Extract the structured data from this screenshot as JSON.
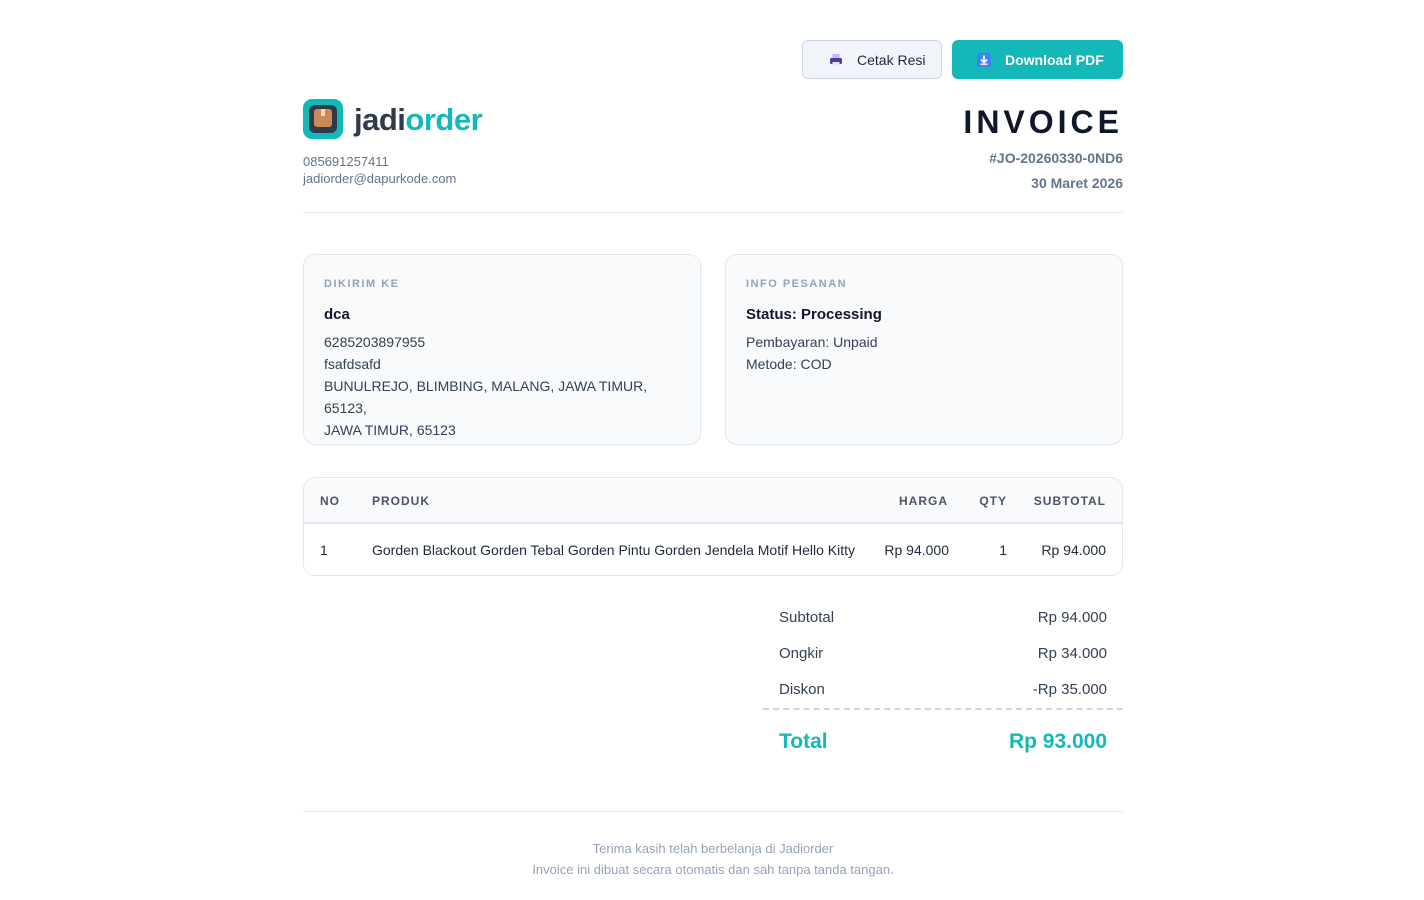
{
  "actions": {
    "print_label": "Cetak Resi",
    "pdf_label": "Download PDF"
  },
  "brand": {
    "name_a": "jadi",
    "name_b": "order",
    "phone": "085691257411",
    "email": "jadiorder@dapurkode.com"
  },
  "invoice": {
    "title": "INVOICE",
    "number": "#JO-20260330-0ND6",
    "date": "30 Maret 2026"
  },
  "shipping": {
    "label": "DIKIRIM KE",
    "name": "dca",
    "phone": "6285203897955",
    "line1": "fsafdsafd",
    "line2": "BUNULREJO, BLIMBING, MALANG, JAWA TIMUR, 65123,",
    "line3": "JAWA TIMUR, 65123"
  },
  "order_info": {
    "label": "INFO PESANAN",
    "status": "Status: Processing",
    "payment": "Pembayaran: Unpaid",
    "method": "Metode: COD"
  },
  "table": {
    "headers": {
      "no": "NO",
      "product": "PRODUK",
      "price": "HARGA",
      "qty": "QTY",
      "subtotal": "SUBTOTAL"
    },
    "rows": [
      {
        "no": "1",
        "product": "Gorden Blackout Gorden Tebal Gorden Pintu Gorden Jendela Motif Hello Kitty",
        "price": "Rp 94.000",
        "qty": "1",
        "subtotal": "Rp 94.000"
      }
    ]
  },
  "totals": {
    "subtotal_label": "Subtotal",
    "subtotal": "Rp 94.000",
    "shipping_label": "Ongkir",
    "shipping": "Rp 34.000",
    "discount_label": "Diskon",
    "discount": "-Rp 35.000",
    "total_label": "Total",
    "total": "Rp 93.000"
  },
  "footer": {
    "line1": "Terima kasih telah berbelanja di Jadiorder",
    "line2": "Invoice ini dibuat secara otomatis dan sah tanpa tanda tangan."
  },
  "colors": {
    "accent": "#14b8b8",
    "dark": "#2f3b4a"
  },
  "icons": {
    "print": "printer-icon",
    "download": "download-icon"
  }
}
